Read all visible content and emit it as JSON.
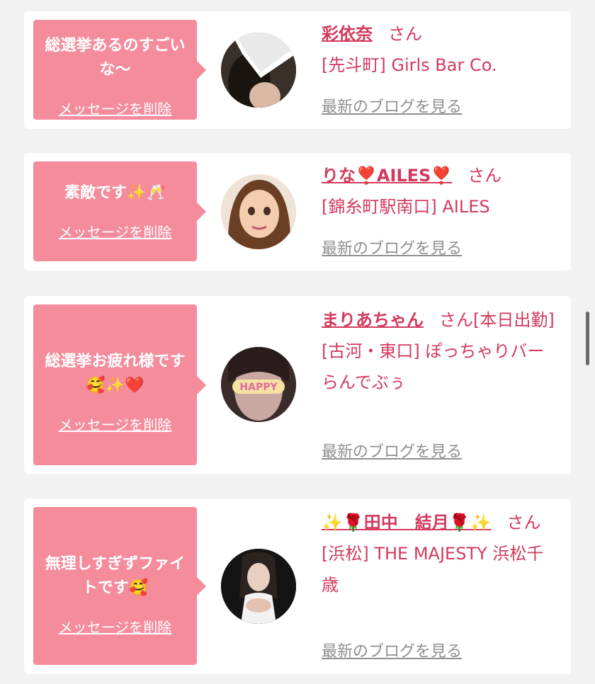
{
  "items": [
    {
      "message": "総選挙あるのすごいな〜",
      "delete_label": "メッセージを削除",
      "name": "彩依奈",
      "honorific": "さん",
      "shop": "[先斗町] Girls Bar Co.",
      "blog_link": "最新のブログを見る"
    },
    {
      "message": "素敵です✨🥂",
      "delete_label": "メッセージを削除",
      "name": "りな❣️AILES❣️",
      "honorific": "さん",
      "shop": "[錦糸町駅南口] AILES",
      "blog_link": "最新のブログを見る"
    },
    {
      "message": "総選挙お疲れ様です🥰✨❤️",
      "delete_label": "メッセージを削除",
      "name": "まりあちゃん",
      "honorific": "さん[本日出勤]",
      "shop": "[古河・東口] ぽっちゃりバー らんでぶぅ",
      "blog_link": "最新のブログを見る",
      "avatar_text": "HAPPY"
    },
    {
      "message": "無理しすぎずファイトです🥰",
      "delete_label": "メッセージを削除",
      "name": "✨🌹田中　結月🌹✨",
      "honorific": "さん",
      "shop": "[浜松] THE MAJESTY 浜松千歳",
      "blog_link": "最新のブログを見る"
    }
  ],
  "colors": {
    "page_bg": "#f2f2f2",
    "bubble": "#f48c9c",
    "accent": "#d23a5e",
    "link_gray": "#8f8f8f"
  }
}
